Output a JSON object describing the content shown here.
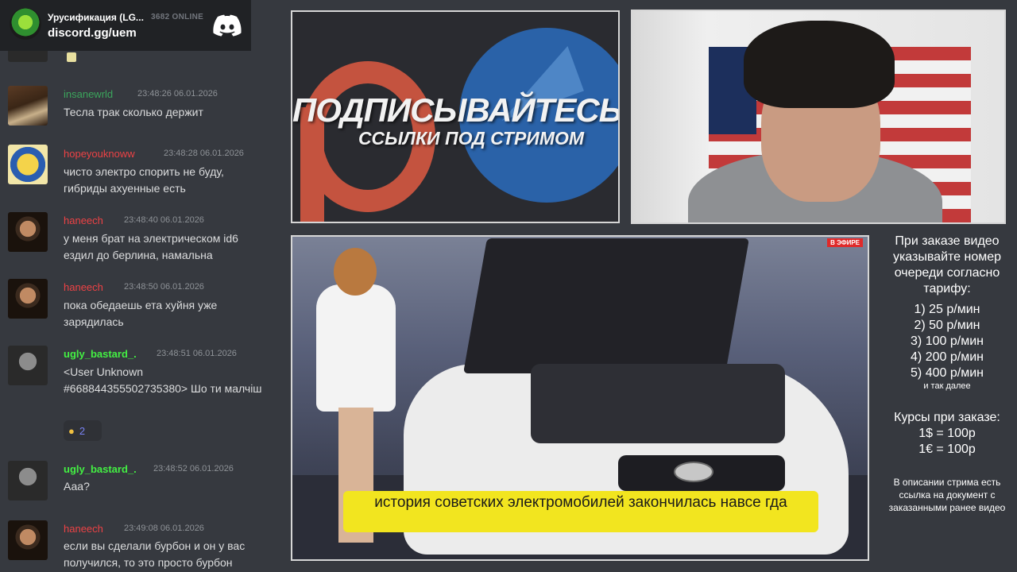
{
  "widget": {
    "server_name": "Урусификация (LG...",
    "online": "3682 ONLINE",
    "invite": "discord.gg/uem"
  },
  "messages": [
    {
      "username": "insanewrld",
      "time": "23:48:26 06.01.2026",
      "text": "Тесла трак сколько держит"
    },
    {
      "username": "hopeyouknoww",
      "time": "23:48:28 06.01.2026",
      "text": "чисто электро спорить не буду, гибриды ахуенные есть"
    },
    {
      "username": "haneech",
      "time": "23:48:40 06.01.2026",
      "text": "у меня брат на электрическом id6 ездил до берлина, намальна"
    },
    {
      "username": "haneech",
      "time": "23:48:50 06.01.2026",
      "text": "пока обедаешь ета хуйня уже зарядилась"
    },
    {
      "username": "ugly_bastard_.",
      "time": "23:48:51 06.01.2026",
      "text": "<User Unknown #668844355502735380> Шо ти малчіш",
      "reaction_count": "2"
    },
    {
      "username": "ugly_bastard_.",
      "time": "23:48:52 06.01.2026",
      "text": "Ааа?"
    },
    {
      "username": "haneech",
      "time": "23:49:08 06.01.2026",
      "text": "если вы сделали бурбон и он у вас получился, то это просто бурбон"
    }
  ],
  "banner": {
    "title": "ПОДПИСЫВАЙТЕСЬ",
    "subtitle": "ССЫЛКИ ПОД СТРИМОМ"
  },
  "video": {
    "live_tag": "В ЭФИРЕ",
    "caption": "история советских электромобилей закончилась навсе гда"
  },
  "info": {
    "order_title": "При заказе видео указывайте номер очереди согласно тарифу:",
    "tariffs": [
      "1) 25 р/мин",
      "2) 50 р/мин",
      "3) 100 р/мин",
      "4) 200 р/мин",
      "5) 400 р/мин"
    ],
    "etc": "и так далее",
    "rates_title": "Курсы при заказе:",
    "rates": [
      "1$ = 100р",
      "1€ = 100р"
    ],
    "note": "В описании стрима есть ссылка на документ с заказанными ранее видео"
  },
  "colors": {
    "chat_bg": "#36393f",
    "widget_bg": "#202225",
    "caption_bg": "#f2e51f",
    "username_green": "#3ba55c",
    "username_red": "#ed4245",
    "username_bright_green": "#43f043",
    "username_pink": "#f0479b"
  }
}
